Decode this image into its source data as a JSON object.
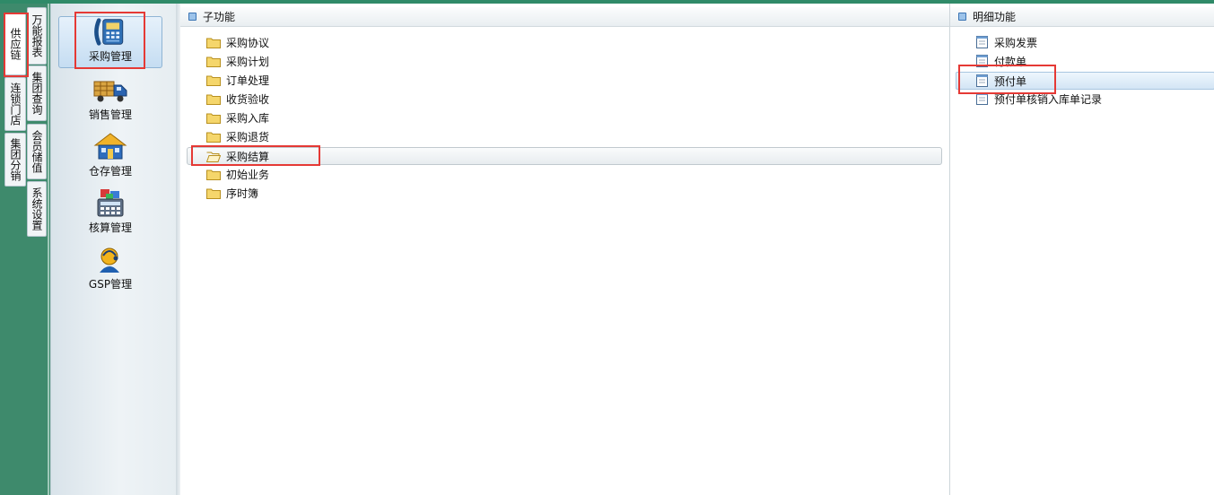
{
  "vertical_tabs": {
    "col1": [
      {
        "label": "供应链",
        "active": true
      },
      {
        "label": "连锁门店",
        "active": false
      },
      {
        "label": "集团分销",
        "active": false
      }
    ],
    "col2": [
      {
        "label": "万能报表",
        "active": false
      },
      {
        "label": "集团查询",
        "active": false
      },
      {
        "label": "会员储值",
        "active": false
      },
      {
        "label": "系统设置",
        "active": false
      }
    ]
  },
  "modules": [
    {
      "label": "采购管理",
      "icon": "purchase-phone-icon",
      "selected": true
    },
    {
      "label": "销售管理",
      "icon": "delivery-truck-icon",
      "selected": false
    },
    {
      "label": "仓存管理",
      "icon": "warehouse-house-icon",
      "selected": false
    },
    {
      "label": "核算管理",
      "icon": "calculator-icon",
      "selected": false
    },
    {
      "label": "GSP管理",
      "icon": "person-headset-icon",
      "selected": false
    }
  ],
  "sub_functions": {
    "header": "子功能",
    "items": [
      {
        "label": "采购协议"
      },
      {
        "label": "采购计划"
      },
      {
        "label": "订单处理"
      },
      {
        "label": "收货验收"
      },
      {
        "label": "采购入库"
      },
      {
        "label": "采购退货"
      },
      {
        "label": "采购结算"
      },
      {
        "label": "初始业务"
      },
      {
        "label": "序时簿"
      }
    ],
    "selected_index": 6
  },
  "detail_functions": {
    "header": "明细功能",
    "items": [
      {
        "label": "采购发票"
      },
      {
        "label": "付款单"
      },
      {
        "label": "预付单"
      },
      {
        "label": "预付单核销入库单记录"
      }
    ],
    "selected_index": 2
  },
  "colors": {
    "highlight": "#e53935",
    "sidebar_green": "#3e8a6c",
    "selection_blue": "#d3e5f5"
  }
}
